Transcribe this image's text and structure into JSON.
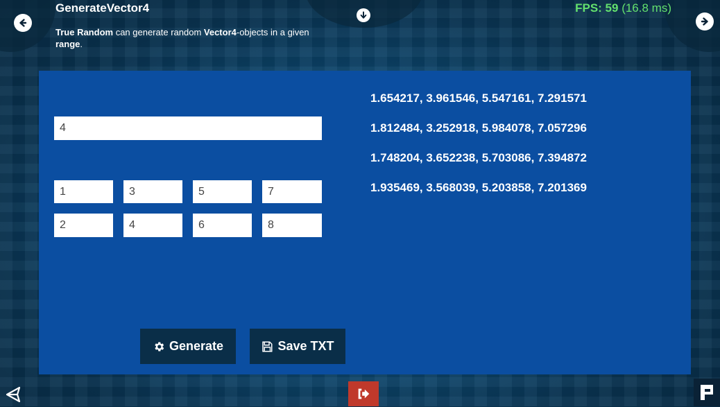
{
  "header": {
    "title": "GenerateVector4",
    "description": {
      "part1_bold": "True Random",
      "part2": " can generate random ",
      "part3_bold": "Vector4",
      "part4": "-objects in a given ",
      "part5_bold": "range",
      "part6": "."
    }
  },
  "fps": {
    "label": "FPS: 59",
    "ms": " (16.8 ms)",
    "color": "#63e06e"
  },
  "form": {
    "count_value": "4",
    "min": [
      "1",
      "3",
      "5",
      "7"
    ],
    "max": [
      "2",
      "4",
      "6",
      "8"
    ]
  },
  "results": [
    "1.654217, 3.961546, 5.547161, 7.291571",
    "1.812484, 3.252918, 5.984078, 7.057296",
    "1.748204, 3.652238, 5.703086, 7.394872",
    "1.935469, 3.568039, 5.203858, 7.201369"
  ],
  "buttons": {
    "generate_label": "Generate",
    "save_label": "Save TXT"
  },
  "icons": {
    "prev": "arrow-left-circle-icon",
    "next": "arrow-right-circle-icon",
    "down": "arrow-down-circle-icon",
    "gear": "gear-icon",
    "save": "floppy-disk-icon",
    "exit": "exit-icon",
    "unity": "unity-logo-icon",
    "flag": "flag-icon"
  },
  "colors": {
    "panel": "#0b4ea1",
    "button": "#0a2e48",
    "exit": "#c0392b"
  }
}
